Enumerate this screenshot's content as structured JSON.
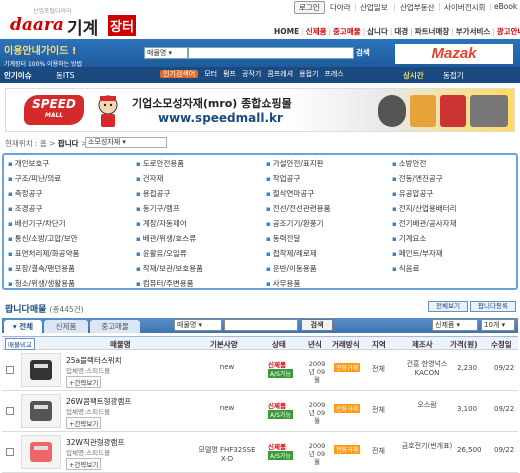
{
  "top_links": {
    "login": "로그인",
    "daara": "다아라",
    "ilbo": "산업일보",
    "realestate": "산업부동산",
    "cyber": "사이버전시회",
    "ebook": "eBook"
  },
  "logo": {
    "tagline": "산업포털다아라",
    "brand": "daara",
    "korean": "기계",
    "box": "장터"
  },
  "main_nav": [
    "HOME",
    "신제품",
    "중고매물",
    "삽니다",
    "대경",
    "파트너매장",
    "부가서비스",
    "광고안내"
  ],
  "main_nav_active": [
    1,
    2,
    7
  ],
  "guide": {
    "title": "이용안내가이드 !",
    "subtitle": "기계장터 100% 이용하는 방법"
  },
  "search": {
    "select": "매물명",
    "button": "검색",
    "ad": "Mazak"
  },
  "darkbar": {
    "hot": "인기이슈",
    "its": "동ITS",
    "categories": [
      "인기검색어",
      "모터",
      "펌프",
      "공작기",
      "콤프레셔",
      "용접기",
      "프레스"
    ],
    "right": "상시간",
    "right2": "동접기"
  },
  "banner": {
    "logo": "SPEED",
    "logo_sub": "MALL",
    "line1": "기업소모성자재(mro) 종합쇼핑몰",
    "line2": "www.speedmall.kr"
  },
  "breadcrumb": {
    "prefix": "현재위치 : 홈 > ",
    "current": "팝니다",
    "sep": " >",
    "select": "소모성자재"
  },
  "categories": [
    [
      "개인보호구",
      "도로안전용품",
      "가설안전/표지판",
      "소방안전"
    ],
    [
      "구조/피난/의료",
      "건자재",
      "작업공구",
      "전동/엔진공구"
    ],
    [
      "측정공구",
      "용접공구",
      "절삭연마공구",
      "유공압공구"
    ],
    [
      "조경공구",
      "동기구/램프",
      "전선/전선관련용품",
      "전지/산업용배터리"
    ],
    [
      "배선기구/차단기",
      "계장/자동제어",
      "공조기기/환풍기",
      "전기배관/공사자재"
    ],
    [
      "통신/소방/고압/보안",
      "배관/위생/호스류",
      "동력전달",
      "기계요소"
    ],
    [
      "표면처리제/화공약품",
      "윤활유/오일류",
      "접착제/례로제",
      "페인트/부자재"
    ],
    [
      "포장/결속/팬던용품",
      "작재/보관/보호용품",
      "운반/이동용품",
      "식음료"
    ],
    [
      "청소/위생/생활용품",
      "컴퓨터/주변용품",
      "사무용품",
      ""
    ]
  ],
  "list": {
    "title": "팝니다매물",
    "count": "(총445건)",
    "all_view": "전체보기",
    "register": "팝니다등록"
  },
  "tabs": [
    "전체",
    "신제품",
    "중고매물"
  ],
  "filter": {
    "select": "매물명",
    "search": "검색",
    "sort1": "신제품",
    "sort2": "10개"
  },
  "columns": {
    "compare": "매물비교",
    "name": "매물명",
    "spec": "기본사양",
    "status": "상태",
    "year": "년식",
    "method": "거래방식",
    "region": "지역",
    "maker": "제조사",
    "price": "가격(원)",
    "date": "수정일"
  },
  "items": [
    {
      "name": "25a블랙터스위치",
      "seller": "업체명:스피드몰",
      "more": "+간략보기",
      "spec": "new",
      "status": "신제품",
      "as": "A/S가능",
      "year": "2009년 09월",
      "method": "전화거래",
      "region": "전체",
      "maker": "건흥 한영넉스 KACON",
      "price": "2,230",
      "date": "09/22"
    },
    {
      "name": "26W콤팩트형광램프",
      "seller": "업체명:스피드몰",
      "more": "+간략보기",
      "spec": "new",
      "status": "신제품",
      "as": "A/S가능",
      "year": "2009년 09월",
      "method": "전화거래",
      "region": "전체",
      "maker": "오스람",
      "price": "3,100",
      "date": "09/22"
    },
    {
      "name": "32W직관형광램프",
      "seller": "업체명:스피드몰",
      "more": "+간략보기",
      "spec": "모델명 FHF32SSE X-D",
      "status": "신제품",
      "as": "A/S가능",
      "year": "2009년 09월",
      "method": "전화거래",
      "region": "전체",
      "maker": "금호전기(번개표)",
      "price": "26,500",
      "date": "09/22"
    }
  ],
  "colors": {
    "blue": "#2c74bd",
    "dark_blue": "#1b4a80",
    "red": "#cc0000",
    "orange": "#ff9a1a",
    "green": "#3a9a3a"
  }
}
